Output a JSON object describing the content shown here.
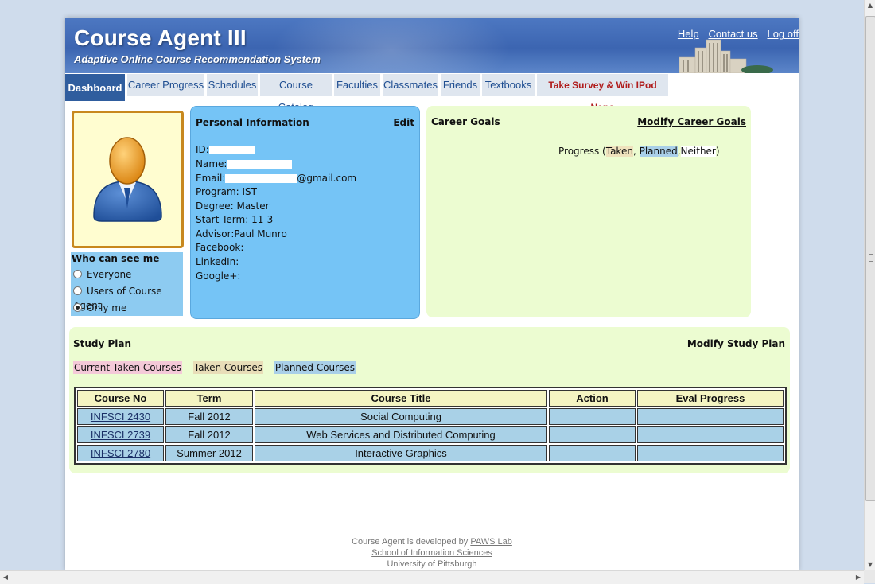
{
  "header": {
    "title": "Course Agent III",
    "subtitle": "Adaptive Online Course Recommendation System",
    "links": {
      "help": "Help",
      "contact": "Contact us",
      "logout": "Log off"
    }
  },
  "nav": {
    "tabs": [
      {
        "label": "Dashboard",
        "active": true
      },
      {
        "label": "Career Progress"
      },
      {
        "label": "Schedules"
      },
      {
        "label": "Course Catalog"
      },
      {
        "label": "Faculties"
      },
      {
        "label": "Classmates"
      },
      {
        "label": "Friends"
      },
      {
        "label": "Textbooks"
      },
      {
        "label": "Take Survey & Win IPod Nano",
        "color": "#b01c1c"
      }
    ]
  },
  "privacy": {
    "title": "Who can see me",
    "options": [
      {
        "label": "Everyone",
        "selected": false
      },
      {
        "label": "Users of Course Agent",
        "selected": false
      },
      {
        "label": "Only me",
        "selected": true
      }
    ]
  },
  "personal": {
    "title": "Personal Information",
    "edit_label": "Edit",
    "id_label": "ID:",
    "name_label": "Name:",
    "email_label": "Email:",
    "email_suffix": "@gmail.com",
    "program": "Program: IST",
    "degree": "Degree: Master",
    "start_term": "Start Term: 11-3",
    "advisor": "Advisor:Paul Munro",
    "facebook": "Facebook:",
    "linkedin": "LinkedIn:",
    "googleplus": "Google+:"
  },
  "career": {
    "title": "Career Goals",
    "modify_label": "Modify Career Goals",
    "progress_prefix": "Progress (",
    "taken": "Taken",
    "sep1": ", ",
    "planned": "Planned",
    "sep2": ",",
    "neither": "Neither",
    "progress_suffix": ")"
  },
  "study_plan": {
    "title": "Study Plan",
    "modify_label": "Modify Study Plan",
    "legend": {
      "current": "Current Taken Courses",
      "taken": "Taken Courses",
      "planned": "Planned Courses"
    },
    "columns": [
      "Course No",
      "Term",
      "Course Title",
      "Action",
      "Eval Progress"
    ],
    "rows": [
      {
        "course_no": "INFSCI 2430",
        "term": "Fall 2012",
        "title": "Social Computing",
        "action": "",
        "eval": ""
      },
      {
        "course_no": "INFSCI 2739",
        "term": "Fall 2012",
        "title": "Web Services and Distributed Computing",
        "action": "",
        "eval": ""
      },
      {
        "course_no": "INFSCI 2780",
        "term": "Summer 2012",
        "title": "Interactive Graphics",
        "action": "",
        "eval": ""
      }
    ]
  },
  "footer": {
    "line1_prefix": "Course Agent is developed by ",
    "line1_link": "PAWS Lab",
    "line2": "School of Information Sciences",
    "line3": "University of Pittsburgh"
  },
  "colors": {
    "header_blue": "#3c65b1",
    "active_tab": "#2f5d9e",
    "personal_panel": "#75c4f6",
    "career_panel": "#ecfcd1",
    "taken_highlight": "#efe2bd",
    "planned_highlight": "#a9cfe8",
    "current_highlight": "#f4c9d8"
  }
}
